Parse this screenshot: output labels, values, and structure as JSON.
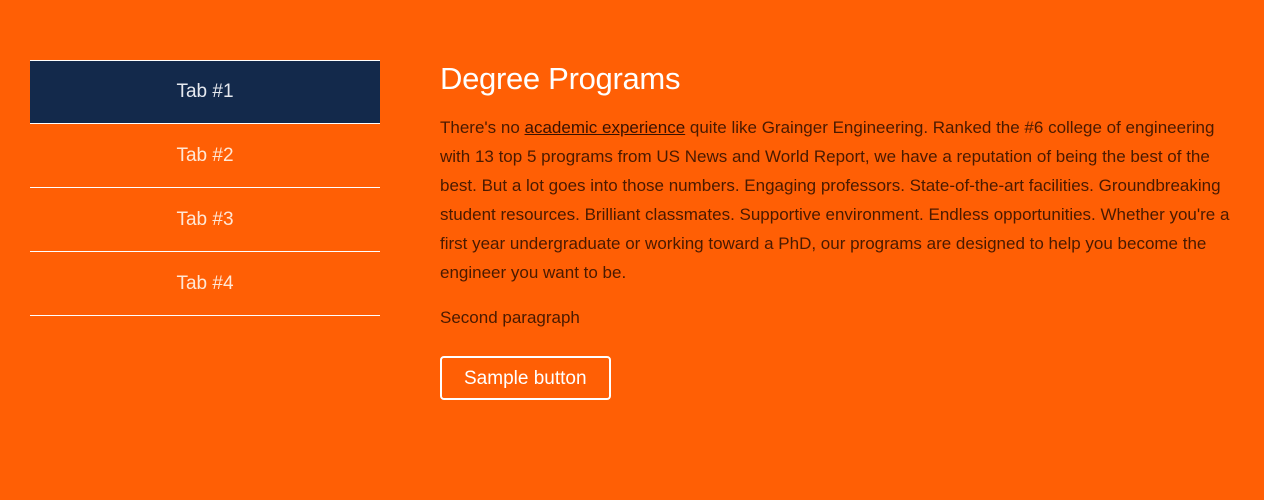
{
  "tabs": [
    {
      "label": "Tab #1",
      "active": true
    },
    {
      "label": "Tab #2",
      "active": false
    },
    {
      "label": "Tab #3",
      "active": false
    },
    {
      "label": "Tab #4",
      "active": false
    }
  ],
  "content": {
    "title": "Degree Programs",
    "paragraph1": {
      "before_link": "There's no ",
      "link_text": "academic experience",
      "after_link": " quite like Grainger Engineering. Ranked the #6 college of engineering with 13 top 5 programs from US News and World Report, we have a reputation of being the best of the best. But a lot goes into those numbers. Engaging professors. State-of-the-art facilities. Groundbreaking student resources. Brilliant classmates. Supportive environment. Endless opportunities. Whether you're a first year undergraduate or working toward a PhD, our programs are designed to help you become the engineer you want to be."
    },
    "paragraph2": "Second paragraph",
    "button_label": "Sample button"
  },
  "colors": {
    "background": "#FF5F05",
    "active_tab": "#13294B",
    "divider": "#FFFFFF"
  }
}
